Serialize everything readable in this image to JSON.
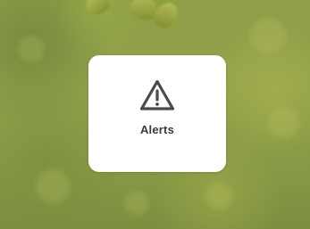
{
  "background": {
    "description_colors": [
      "#8f9f48",
      "#b8c05a",
      "#7d8f40"
    ]
  },
  "alert_card": {
    "label": "Alerts",
    "icon": "warning-triangle-icon",
    "icon_color": "#4a4a4a",
    "card_color": "#ffffff"
  }
}
